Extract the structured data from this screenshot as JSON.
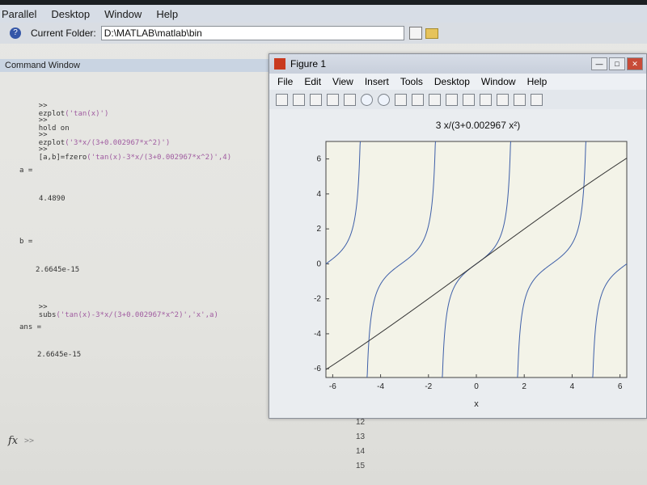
{
  "menubar": {
    "items": [
      "Parallel",
      "Desktop",
      "Window",
      "Help"
    ]
  },
  "toolbar": {
    "current_folder_label": "Current Folder:",
    "current_folder_value": "D:\\MATLAB\\matlab\\bin"
  },
  "command_window": {
    "title": "Command Window",
    "lines": [
      {
        "prompt": ">>",
        "cmd": "ezplot",
        "arg": "('tan(x)')"
      },
      {
        "prompt": ">>",
        "cmd": "hold on",
        "arg": ""
      },
      {
        "prompt": ">>",
        "cmd": "ezplot",
        "arg": "('3*x/(3+0.002967*x^2)')"
      },
      {
        "prompt": ">>",
        "cmd": "[a,b]=fzero",
        "arg": "('tan(x)-3*x/(3+0.002967*x^2)',4)"
      }
    ],
    "a_label": "a =",
    "a_value": "4.4890",
    "b_label": "b =",
    "b_value": "2.6645e-15",
    "subs_line": {
      "prompt": ">>",
      "cmd": "subs",
      "arg": "('tan(x)-3*x/(3+0.002967*x^2)','x',a)"
    },
    "ans_label": "ans =",
    "ans_value": "2.6645e-15",
    "fx_prompt": ">>"
  },
  "editor_line_numbers": [
    "12",
    "13",
    "14",
    "15"
  ],
  "figure": {
    "title": "Figure 1",
    "menu": [
      "File",
      "Edit",
      "View",
      "Insert",
      "Tools",
      "Desktop",
      "Window",
      "Help"
    ]
  },
  "chart_data": {
    "type": "line",
    "title": "3 x/(3+0.002967 x²)",
    "xlabel": "x",
    "ylabel": "",
    "xlim": [
      -6.283,
      6.283
    ],
    "ylim": [
      -6.5,
      7
    ],
    "xticks": [
      -6,
      -4,
      -2,
      0,
      2,
      4,
      6
    ],
    "yticks": [
      -6,
      -4,
      -2,
      0,
      2,
      4,
      6
    ],
    "grid": false,
    "series": [
      {
        "expr": "tan(x)"
      },
      {
        "expr": "3*x/(3+0.002967*x^2)"
      }
    ]
  }
}
